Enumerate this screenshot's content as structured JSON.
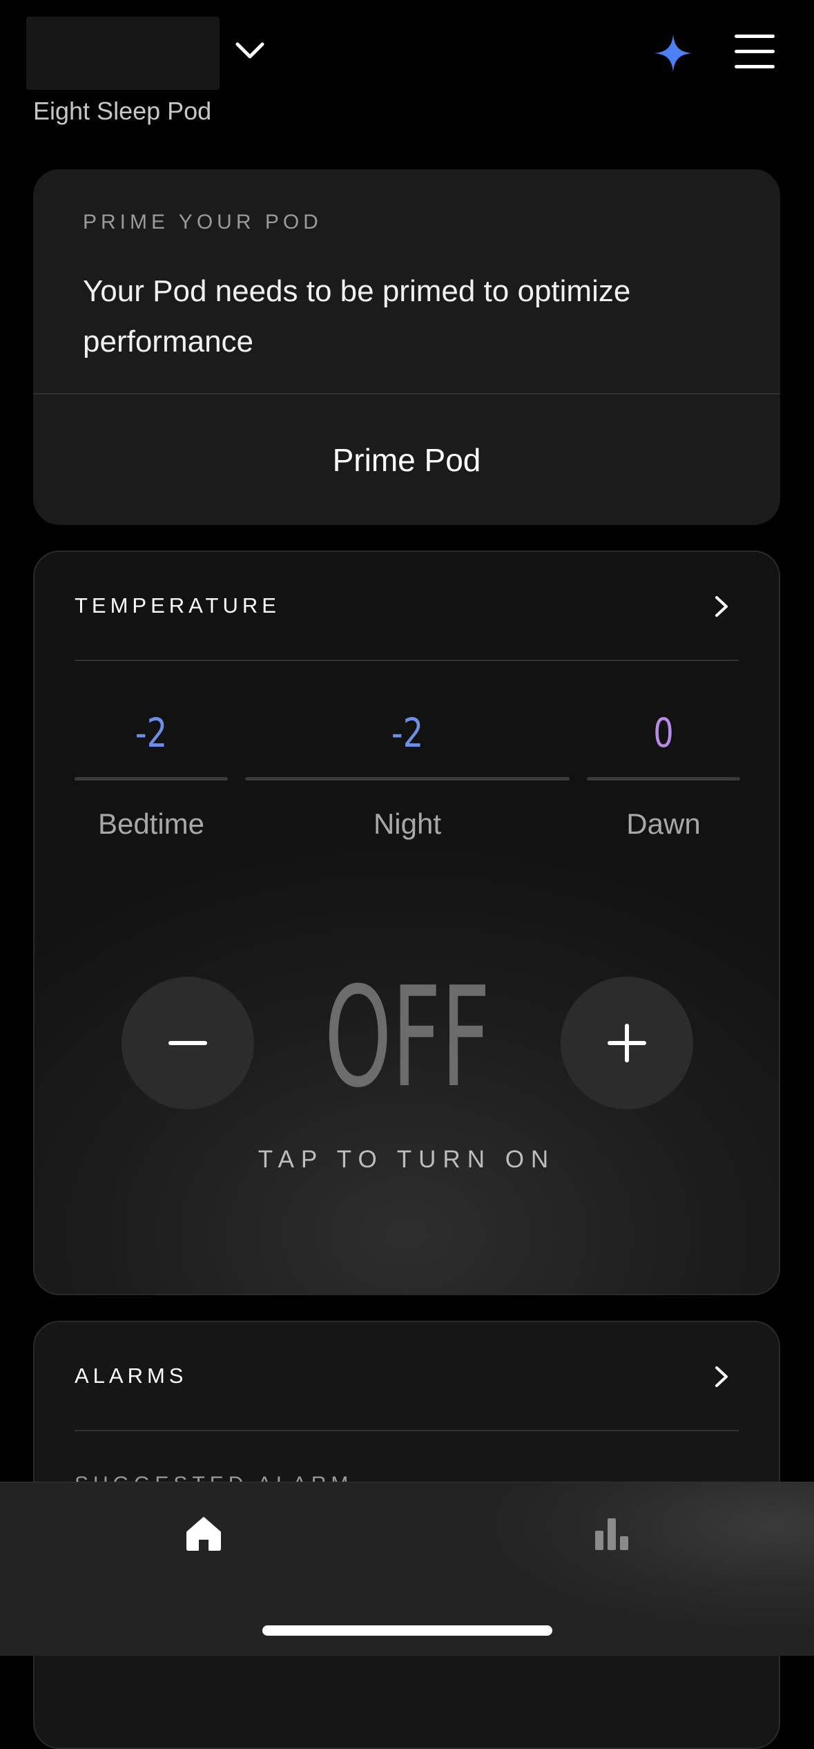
{
  "header": {
    "device_name": "Eight Sleep Pod",
    "icons": [
      "chevron-down-icon",
      "sparkle-icon",
      "menu-icon"
    ],
    "accent_color": "#4d7ff5"
  },
  "prime_card": {
    "eyebrow": "PRIME YOUR POD",
    "message": "Your Pod needs to be primed to optimize performance",
    "button_label": "Prime Pod"
  },
  "temperature": {
    "title": "TEMPERATURE",
    "phases": [
      {
        "label": "Bedtime",
        "value": "-2",
        "color": "#6f8fe6"
      },
      {
        "label": "Night",
        "value": "-2",
        "color": "#6f8fe6"
      },
      {
        "label": "Dawn",
        "value": "0",
        "color": "#b78be3"
      }
    ],
    "state": "OFF",
    "hint": "TAP TO TURN ON"
  },
  "alarms": {
    "title": "ALARMS",
    "subtitle": "SUGGESTED ALARM"
  },
  "tabbar": {
    "tabs": [
      "home-icon",
      "stats-icon"
    ]
  }
}
